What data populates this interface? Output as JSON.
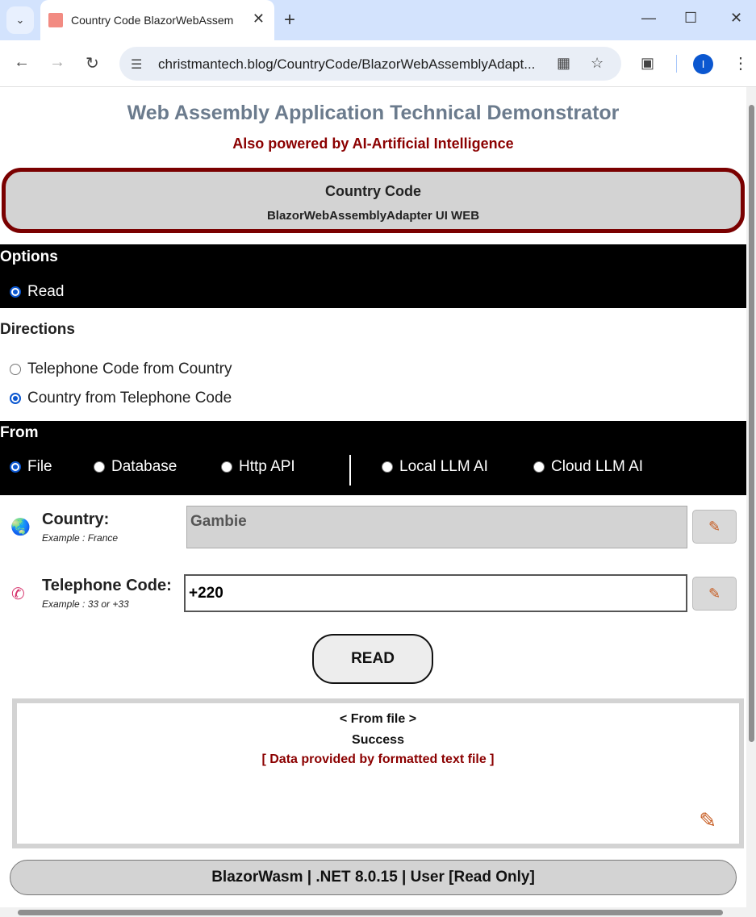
{
  "browser": {
    "tab_title": "Country Code BlazorWebAssem",
    "url": "christmantech.blog/CountryCode/BlazorWebAssemblyAdapt...",
    "profile_initial": "I"
  },
  "page": {
    "title": "Web Assembly Application Technical Demonstrator",
    "subtitle": "Also powered by AI-Artificial Intelligence",
    "header_title": "Country Code",
    "header_subtitle": "BlazorWebAssemblyAdapter UI WEB"
  },
  "options": {
    "title": "Options",
    "items": [
      {
        "label": "Read",
        "checked": true
      }
    ]
  },
  "directions": {
    "title": "Directions",
    "items": [
      {
        "label": "Telephone Code from Country",
        "checked": false
      },
      {
        "label": "Country from Telephone Code",
        "checked": true
      }
    ]
  },
  "from": {
    "title": "From",
    "items": [
      {
        "label": "File",
        "checked": true
      },
      {
        "label": "Database",
        "checked": false
      },
      {
        "label": "Http API",
        "checked": false
      },
      {
        "label": "Local LLM AI",
        "checked": false
      },
      {
        "label": "Cloud LLM AI",
        "checked": false
      }
    ]
  },
  "country": {
    "label": "Country:",
    "example": "Example : France",
    "value": "Gambie"
  },
  "telephone": {
    "label": "Telephone Code:",
    "example": "Example : 33 or +33",
    "value": "+220"
  },
  "read_button": "READ",
  "result": {
    "source": "< From file >",
    "status": "Success",
    "note": "[ Data provided by formatted text file ]"
  },
  "footer": "BlazorWasm | .NET 8.0.15 | User [Read Only]",
  "colors": {
    "title": "#6b7b8d",
    "accent_red": "#8b0000",
    "header_border": "#7a0000",
    "radio_checked": "#0b57d0"
  }
}
